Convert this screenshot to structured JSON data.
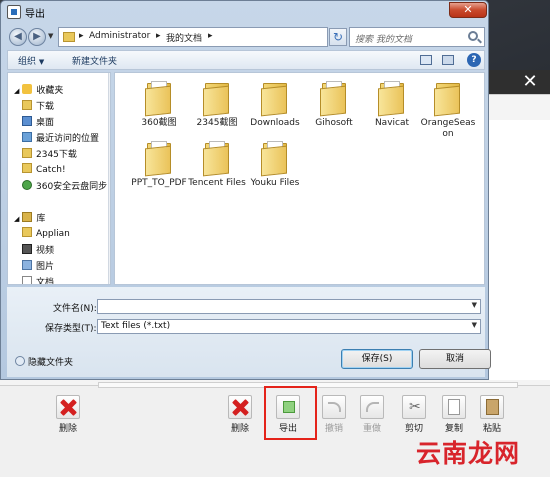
{
  "dialog": {
    "title": "导出",
    "close_label": "✕",
    "address": [
      "Administrator",
      "我的文档"
    ],
    "search_placeholder": "搜索 我的文档",
    "commands": {
      "organize": "组织",
      "new_folder": "新建文件夹"
    },
    "nav": {
      "favorites": "收藏夹",
      "items": [
        "下载",
        "桌面",
        "最近访问的位置",
        "2345下载",
        "Catch!",
        "360安全云盘同步"
      ],
      "library": "库",
      "library_items": [
        "Applian",
        "视频",
        "图片",
        "文档"
      ]
    },
    "files": [
      "360截图",
      "2345截图",
      "Downloads",
      "Gihosoft",
      "Navicat",
      "OrangeSeason",
      "PPT_TO_PDF",
      "Tencent Files",
      "Youku Files"
    ],
    "filename_label": "文件名(N):",
    "filename_value": "",
    "filetype_label": "保存类型(T):",
    "filetype_value": "Text files (*.txt)",
    "hide_folders": "隐藏文件夹",
    "save_button": "保存(S)",
    "cancel_button": "取消"
  },
  "toolbar": {
    "delete_left": "删除",
    "delete": "删除",
    "export": "导出",
    "undo": "撤销",
    "redo": "重做",
    "cut": "剪切",
    "copy": "复制",
    "paste": "粘贴"
  },
  "watermark": "云南龙网",
  "colors": {
    "highlight": "#e4231a",
    "close": "#c94a2c",
    "accent": "#2c66b3"
  }
}
